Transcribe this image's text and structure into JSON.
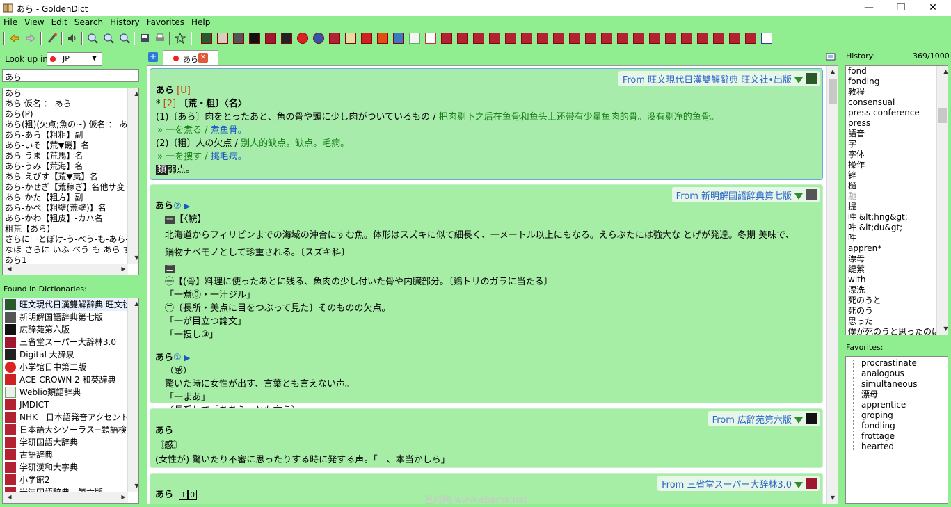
{
  "window": {
    "title": "あら - GoldenDict",
    "min": "—",
    "restore": "❐",
    "close": "✕"
  },
  "menu": [
    "File",
    "View",
    "Edit",
    "Search",
    "History",
    "Favorites",
    "Help"
  ],
  "lookup": {
    "label": "Look up in:",
    "group": "JP",
    "query": "あら"
  },
  "word_list": [
    "あら",
    "あら 仮名 ： あら",
    "あら(P)",
    "あら(粗)(欠点;魚の~) 仮名 ： あら",
    "あら-あら【粗粗】副",
    "あら-いそ【荒▼磯】名",
    "あら-うま【荒馬】名",
    "あら-うみ【荒海】名",
    "あら-えびす【荒▼夷】名",
    "あら-かせぎ【荒稼ぎ】名他サ変",
    "あら-かた【粗方】副",
    "あら-かべ【粗壁(荒壁)】名",
    "あら-かわ【粗皮】-カハ名",
    "粗荒【あら】",
    "さらにーとぼけ-う-べう-も-あら-ず-たちこ",
    "なほ-さらに-いふ-べう-も-あら-ずなほ",
    "あら1"
  ],
  "found_label": "Found in Dictionaries:",
  "found_dicts": [
    "旺文現代日漢雙解辭典 旺文社",
    "新明解国語辞典第七版",
    "広辞苑第六版",
    "三省堂スーパー大辞林3.0",
    "Digital 大辞泉",
    "小学馆日中第二版",
    "ACE-CROWN 2 和英辞典",
    "Weblio類語辞典",
    "JMDICT",
    "NHK　日本語発音アクセント辞典",
    "日本語大シソーラス−類語検索",
    "学研国語大辞典",
    "古語辞典",
    "学研漢和大字典",
    "小学館2",
    "岩波国語辞典　第六版"
  ],
  "tab": {
    "label": "あら",
    "close": "✕"
  },
  "articles": {
    "a1": {
      "from": "From 旺文現代日漢雙解辭典 旺文社•出版",
      "head": "あら",
      "head_tag": "[U]",
      "l2_num": "[2]",
      "l2_rest": "〔荒・粗〕〈名〉",
      "s1_jp": "(1)〔あら〕肉をとったあと、魚の骨や頭に少し肉がついているもの /",
      "s1_cn": " 把肉剔下之后在鱼骨和鱼头上还带有少量鱼肉的骨。没有剔净的鱼骨。",
      "e1_jp": "» 一を煮る /",
      "e1_cn": " 煮鱼骨。",
      "s2_jp": "(2)〔粗〕人の欠点 /",
      "s2_cn": " 别人的缺点。缺点。毛病。",
      "e2_jp": "» 一を捜す /",
      "e2_cn": " 挑毛病。",
      "rel_tag": "類",
      "rel": "弱点。"
    },
    "a2": {
      "from": "From 新明解国語辞典第七版",
      "h1": "あら",
      "h1_num": "②",
      "b1_label": "【〈鯇】",
      "b1_text": "北海道からフィリピンまでの海域の沖合にすむ魚。体形はスズキに似て細長く、一メートル以上にもなる。えらぶたには強大な とげが発達。冬期 美味で、鍋物ナベモノとして珍重される。〔スズキ科〕",
      "b2_text": "㊀【(骨】料理に使ったあとに残る、魚肉の少し付いた骨や内臓部分。〔鶏トリのガラに当たる〕",
      "b2_ex1": "「一煮⓪・一汁ジル」",
      "b2_text2": "㊁〔長所・美点に目をつぶって見た〕そのものの欠点。",
      "b2_ex2": "「一が目立つ論文」",
      "b2_ex3": "「一捜し③」",
      "h2": "あら",
      "h2_num": "①",
      "c_pos": "（感）",
      "c_text": "驚いた時に女性が出す、言葉とも言えない声。",
      "c_ex": "「一まあ」",
      "c_note": "〔長呼して「ああら」とも言う〕"
    },
    "a3": {
      "from": "From 広辞苑第六版",
      "head": "あら",
      "pos": "〘感〙",
      "text": "(女性が) 驚いたり不審に思ったりする時に発する声。「—、本当かしら」"
    },
    "a4": {
      "from": "From 三省堂スーパー大辞林3.0",
      "head": "あら",
      "n1": "1",
      "n2": "0"
    }
  },
  "history": {
    "label": "History:",
    "count": "369/1000",
    "items": [
      "fond",
      "fonding",
      "教程",
      "consensual",
      "press conference",
      "press",
      "語音",
      "字",
      "字体",
      "操作",
      "锌",
      "樋",
      "馳",
      "提",
      "吽 &lt;hng&gt;",
      "吽 &lt;du&gt;",
      "吽",
      "appren*",
      "漂母",
      "缇萦",
      "with",
      "漂洗",
      "死のうと",
      "死のう",
      "思った",
      "僕が死のうと思ったのは"
    ]
  },
  "favorites": {
    "label": "Favorites:",
    "items": [
      "procrastinate",
      "analogous",
      "simultaneous",
      "漂母",
      "apprentice",
      "groping",
      "fondling",
      "frottage",
      "hearted"
    ]
  },
  "watermark": "爸妈网 www.ebama.net"
}
